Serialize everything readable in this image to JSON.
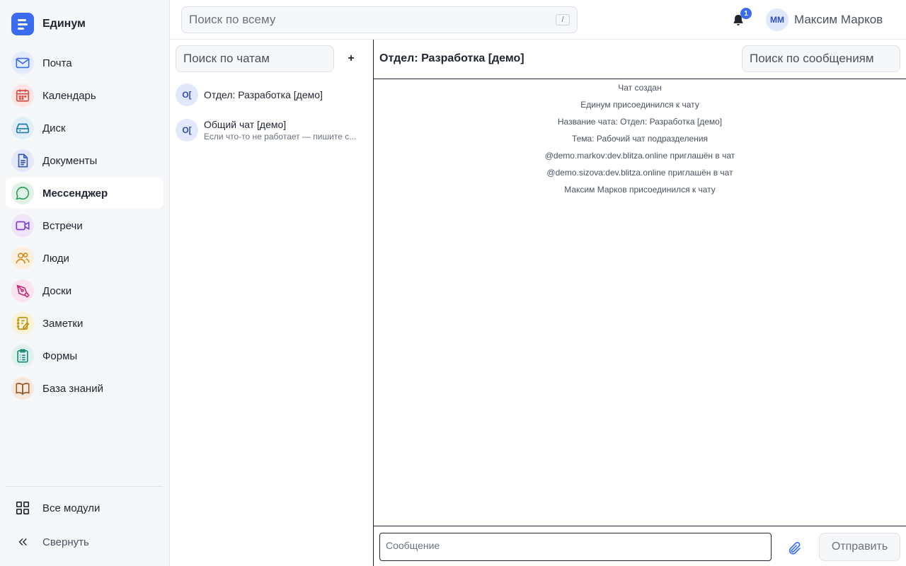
{
  "app": {
    "name": "Единум"
  },
  "sidebar": {
    "items": [
      {
        "label": "Почта",
        "icon": "mail-icon",
        "color": "#3b6cf0",
        "bg": "#e3ebfc"
      },
      {
        "label": "Календарь",
        "icon": "calendar-icon",
        "color": "#e0483e",
        "bg": "#fbe6e4"
      },
      {
        "label": "Диск",
        "icon": "drive-icon",
        "color": "#1f7aa8",
        "bg": "#e0eff7"
      },
      {
        "label": "Документы",
        "icon": "document-icon",
        "color": "#3457c2",
        "bg": "#e3e9f8"
      },
      {
        "label": "Мессенджер",
        "icon": "chat-bubble-icon",
        "color": "#2e9e5b",
        "bg": "#e1f3e8",
        "active": true
      },
      {
        "label": "Встречи",
        "icon": "video-icon",
        "color": "#7b3fd6",
        "bg": "#eee5fb"
      },
      {
        "label": "Люди",
        "icon": "people-icon",
        "color": "#d68a1f",
        "bg": "#fbf0de"
      },
      {
        "label": "Доски",
        "icon": "pen-tool-icon",
        "color": "#c0307a",
        "bg": "#fae3ee"
      },
      {
        "label": "Заметки",
        "icon": "notes-icon",
        "color": "#b8951a",
        "bg": "#faf3d8"
      },
      {
        "label": "Формы",
        "icon": "clipboard-icon",
        "color": "#1f8a7a",
        "bg": "#dff2ee"
      },
      {
        "label": "База знаний",
        "icon": "book-icon",
        "color": "#9a5a2a",
        "bg": "#f5e9df"
      }
    ],
    "all_modules": "Все модули",
    "collapse": "Свернуть"
  },
  "topbar": {
    "search_placeholder": "Поиск по всему",
    "search_shortcut": "/",
    "notification_count": "1",
    "user_initials": "ММ",
    "user_name": "Максим Марков"
  },
  "chatlist": {
    "search_placeholder": "Поиск по чатам",
    "add_label": "+",
    "chats": [
      {
        "initials": "О[",
        "title": "Отдел: Разработка [демо]",
        "preview": ""
      },
      {
        "initials": "О[",
        "title": "Общий чат [демо]",
        "preview": "Если что-то не работает — пишите с..."
      }
    ]
  },
  "chat": {
    "title": "Отдел: Разработка [демо]",
    "search_placeholder": "Поиск по сообщениям",
    "events": [
      "Чат создан",
      "Единум присоединился к чату",
      "Название чата: Отдел: Разработка [демо]",
      "Тема: Рабочий чат подразделения",
      "@demo.markov:dev.blitza.online приглашён в чат",
      "@demo.sizova:dev.blitza.online приглашён в чат",
      "Максим Марков присоединился к чату"
    ],
    "message_placeholder": "Сообщение",
    "send_label": "Отправить"
  }
}
